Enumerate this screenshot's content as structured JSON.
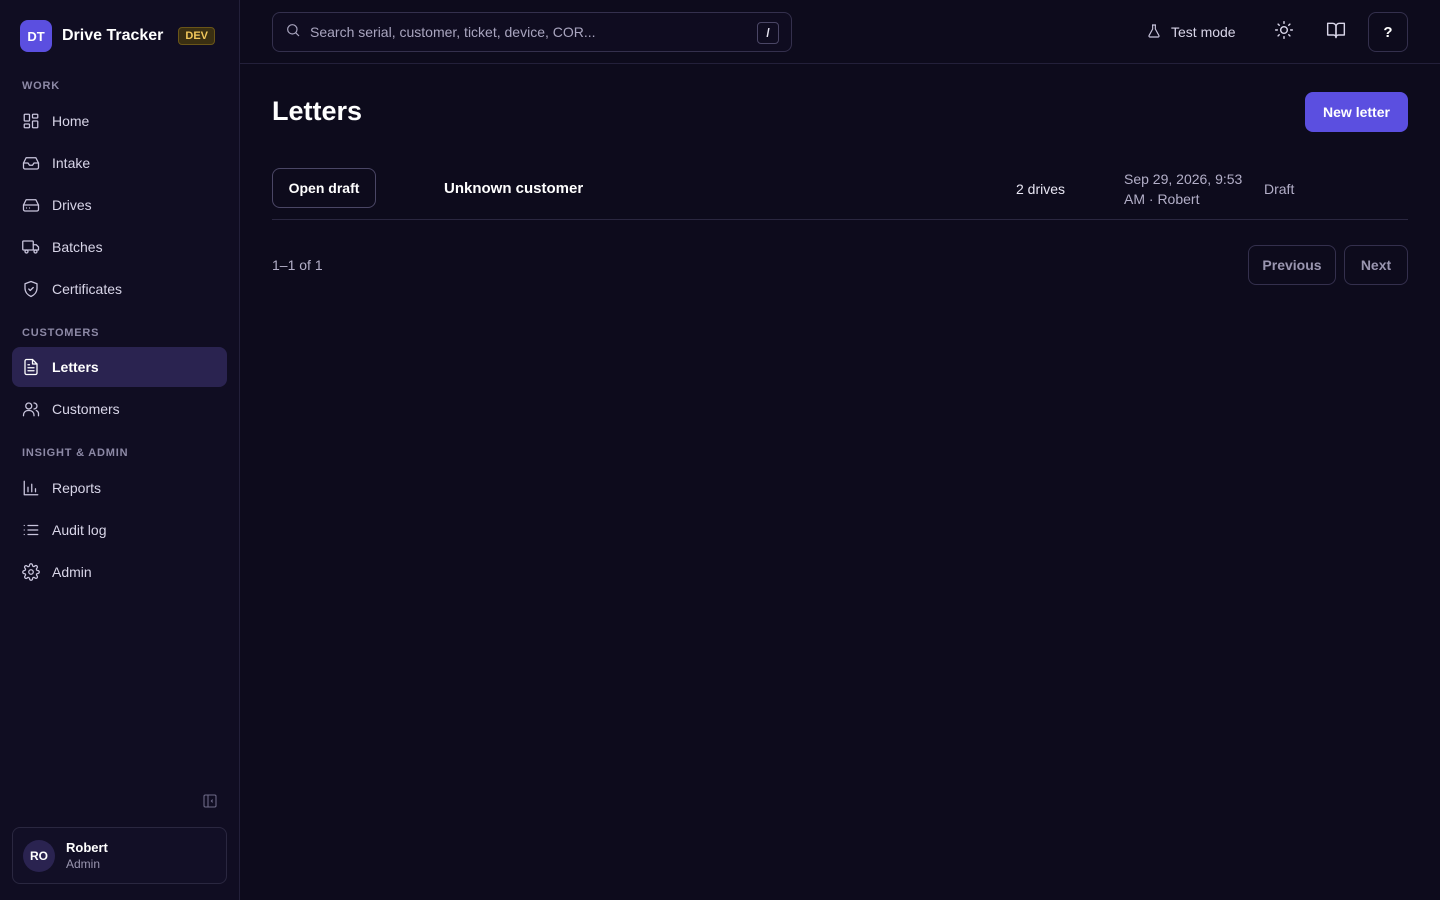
{
  "brand": {
    "logo": "DT",
    "name": "Drive Tracker",
    "badge": "DEV"
  },
  "sidebar": {
    "sections": [
      {
        "label": "WORK"
      },
      {
        "label": "CUSTOMERS"
      },
      {
        "label": "INSIGHT & ADMIN"
      }
    ],
    "items": [
      {
        "label": "Home",
        "icon": "grid-icon"
      },
      {
        "label": "Intake",
        "icon": "inbox-icon"
      },
      {
        "label": "Drives",
        "icon": "hard-drive-icon"
      },
      {
        "label": "Batches",
        "icon": "truck-icon"
      },
      {
        "label": "Certificates",
        "icon": "shield-check-icon"
      },
      {
        "label": "Letters",
        "icon": "document-icon",
        "active": true
      },
      {
        "label": "Customers",
        "icon": "users-icon"
      },
      {
        "label": "Reports",
        "icon": "bar-chart-icon"
      },
      {
        "label": "Audit log",
        "icon": "list-icon"
      },
      {
        "label": "Admin",
        "icon": "gear-icon"
      }
    ]
  },
  "user": {
    "initials": "RO",
    "name": "Robert",
    "role": "Admin"
  },
  "search": {
    "placeholder": "Search serial, customer, ticket, device, COR...",
    "value": "",
    "shortcut": "/"
  },
  "topbar": {
    "test_mode_label": "Test mode",
    "help_label": "?"
  },
  "page": {
    "title": "Letters",
    "new_button": "New letter"
  },
  "letters": [
    {
      "action": "Open draft",
      "customer": "Unknown customer",
      "drives": "2 drives",
      "date_line1": "Sep 29, 2026, 9:53",
      "date_line2": "AM · Robert",
      "status": "Draft"
    }
  ],
  "pagination": {
    "count": "1–1 of 1",
    "previous": "Previous",
    "next": "Next"
  },
  "colors": {
    "accent": "#5b4fe0",
    "background": "#0d0b1c",
    "sidebar": "#100d22",
    "active_item": "#2a2350",
    "badge": "#f1c75b"
  }
}
